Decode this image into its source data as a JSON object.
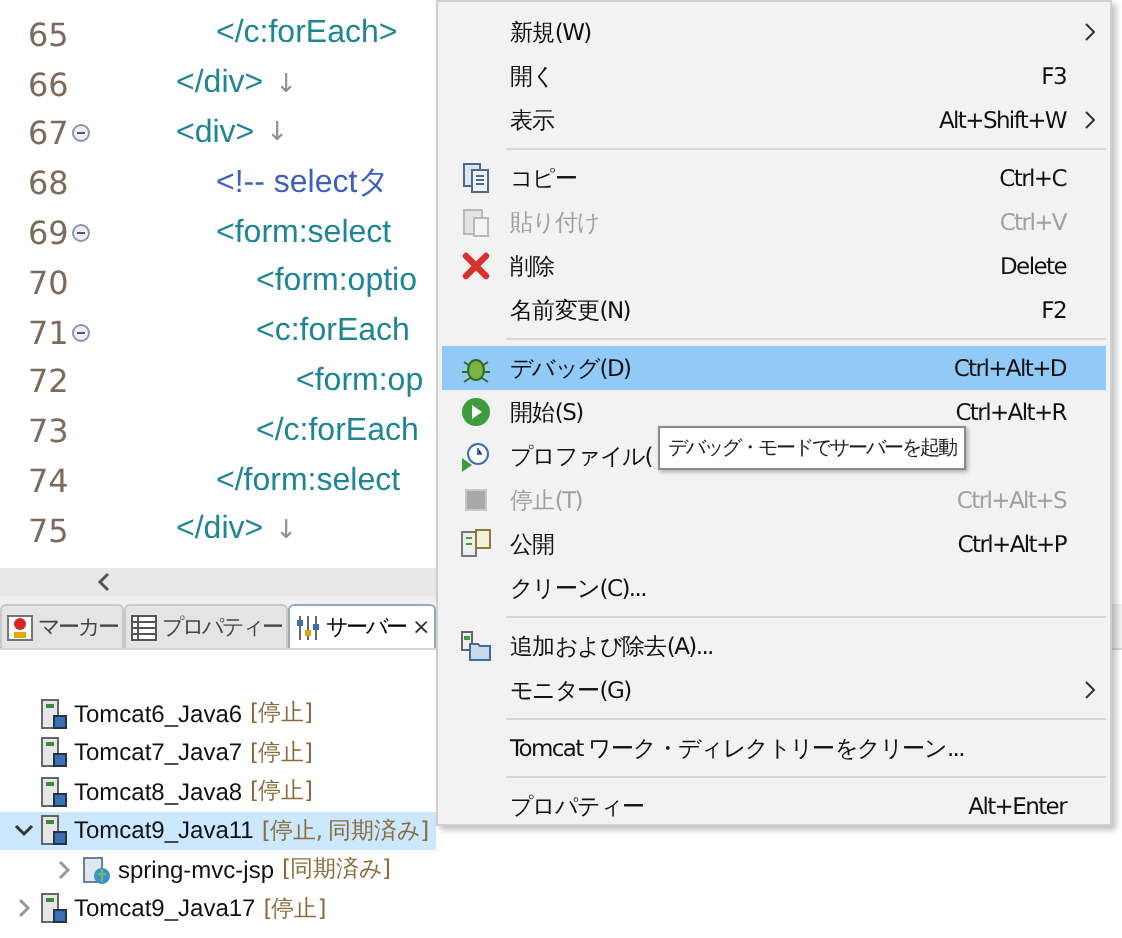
{
  "editor": {
    "lines": [
      {
        "number": "65",
        "text": "\t\t\t</c:forEach>",
        "kind": "tag",
        "fold": false
      },
      {
        "number": "66",
        "text": "\t\t</div>",
        "kind": "tag",
        "fold": false,
        "eol": "↓"
      },
      {
        "number": "67",
        "text": "\t\t<div>",
        "kind": "tag",
        "fold": true,
        "eol": "↓"
      },
      {
        "number": "68",
        "text": "\t\t\t<!-- selectタ",
        "kind": "comment",
        "fold": false
      },
      {
        "number": "69",
        "text": "\t\t\t<form:select",
        "kind": "tag",
        "fold": true
      },
      {
        "number": "70",
        "text": "\t\t\t\t<form:optio",
        "kind": "tag",
        "fold": false
      },
      {
        "number": "71",
        "text": "\t\t\t\t<c:forEach",
        "kind": "tag",
        "fold": true
      },
      {
        "number": "72",
        "text": "\t\t\t\t\t<form:op",
        "kind": "tag",
        "fold": false
      },
      {
        "number": "73",
        "text": "\t\t\t\t</c:forEach",
        "kind": "tag",
        "fold": false
      },
      {
        "number": "74",
        "text": "\t\t\t</form:select",
        "kind": "tag",
        "fold": false
      },
      {
        "number": "75",
        "text": "\t\t</div>",
        "kind": "tag",
        "fold": false,
        "eol": "↓"
      }
    ]
  },
  "views": {
    "tabs": [
      {
        "label": "マーカー",
        "selected": false
      },
      {
        "label": "プロパティー",
        "selected": false
      },
      {
        "label": "サーバー",
        "selected": true,
        "close": "×"
      }
    ],
    "servers": [
      {
        "name": "Tomcat6_Java6",
        "status": "[停止]",
        "selected": false
      },
      {
        "name": "Tomcat7_Java7",
        "status": "[停止]",
        "selected": false
      },
      {
        "name": "Tomcat8_Java8",
        "status": "[停止]",
        "selected": false
      },
      {
        "name": "Tomcat9_Java11",
        "status": "[停止, 同期済み]",
        "selected": true,
        "expanded": true,
        "children": [
          {
            "name": "spring-mvc-jsp",
            "status": "[同期済み]",
            "selected": false,
            "expanded": false,
            "kind": "module"
          }
        ]
      },
      {
        "name": "Tomcat9_Java17",
        "status": "[停止]",
        "selected": false,
        "expanded": false
      }
    ]
  },
  "context_menu": {
    "items": [
      {
        "kind": "item",
        "label": "新規(W)",
        "submenu": true,
        "selected": false,
        "disabled": false
      },
      {
        "kind": "item",
        "label": "開く",
        "shortcut": "F3",
        "selected": false,
        "disabled": false
      },
      {
        "kind": "item",
        "label": "表示",
        "shortcut": "Alt+Shift+W",
        "submenu": true,
        "selected": false,
        "disabled": false
      },
      {
        "kind": "separator"
      },
      {
        "kind": "item",
        "label": "コピー",
        "shortcut": "Ctrl+C",
        "selected": false,
        "disabled": false
      },
      {
        "kind": "item",
        "label": "貼り付け",
        "shortcut": "Ctrl+V",
        "selected": false,
        "disabled": true
      },
      {
        "kind": "item",
        "label": "削除",
        "shortcut": "Delete",
        "selected": false,
        "disabled": false
      },
      {
        "kind": "item",
        "label": "名前変更(N)",
        "shortcut": "F2",
        "selected": false,
        "disabled": false
      },
      {
        "kind": "separator"
      },
      {
        "kind": "item",
        "label": "デバッグ(D)",
        "shortcut": "Ctrl+Alt+D",
        "selected": true,
        "disabled": false
      },
      {
        "kind": "item",
        "label": "開始(S)",
        "shortcut": "Ctrl+Alt+R",
        "selected": false,
        "disabled": false
      },
      {
        "kind": "item",
        "label": "プロファイル(",
        "selected": false,
        "disabled": false
      },
      {
        "kind": "item",
        "label": "停止(T)",
        "shortcut": "Ctrl+Alt+S",
        "selected": false,
        "disabled": true
      },
      {
        "kind": "item",
        "label": "公開",
        "shortcut": "Ctrl+Alt+P",
        "selected": false,
        "disabled": false
      },
      {
        "kind": "item",
        "label": "クリーン(C)...",
        "selected": false,
        "disabled": false
      },
      {
        "kind": "separator"
      },
      {
        "kind": "item",
        "label": "追加および除去(A)...",
        "selected": false,
        "disabled": false
      },
      {
        "kind": "item",
        "label": "モニター(G)",
        "submenu": true,
        "selected": false,
        "disabled": false
      },
      {
        "kind": "separator"
      },
      {
        "kind": "item",
        "label": "Tomcat ワーク・ディレクトリーをクリーン...",
        "selected": false,
        "disabled": false
      },
      {
        "kind": "separator"
      },
      {
        "kind": "item",
        "label": "プロパティー",
        "shortcut": "Alt+Enter",
        "selected": false,
        "disabled": false
      }
    ]
  },
  "tooltip": {
    "text": "デバッグ・モードでサーバーを起動"
  }
}
